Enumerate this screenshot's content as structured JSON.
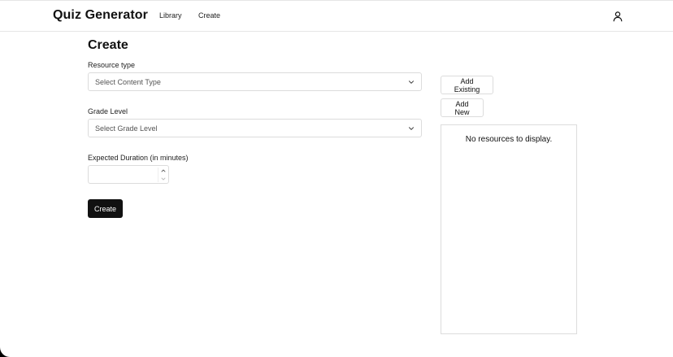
{
  "header": {
    "brand": "Quiz Generator",
    "nav": [
      {
        "label": "Library"
      },
      {
        "label": "Create"
      }
    ],
    "user_icon": "user-icon"
  },
  "main": {
    "title": "Create",
    "resource_type": {
      "label": "Resource type",
      "placeholder": "Select Content Type",
      "icon": "chevron-down-icon"
    },
    "grade_level": {
      "label": "Grade Level",
      "placeholder": "Select Grade Level",
      "icon": "chevron-down-icon"
    },
    "duration": {
      "label": "Expected Duration (in minutes)",
      "value": ""
    },
    "create_label": "Create"
  },
  "sidebar": {
    "add_existing_label": "Add Existing",
    "add_new_label": "Add New",
    "empty_text": "No resources to display."
  }
}
